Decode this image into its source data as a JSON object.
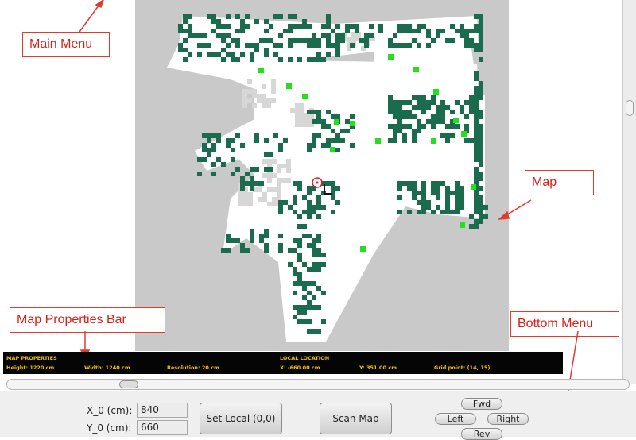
{
  "annotations": {
    "main_menu": "Main Menu",
    "map": "Map",
    "map_properties_bar": "Map Properties Bar",
    "bottom_menu": "Bottom Menu"
  },
  "map_properties": {
    "heading": "MAP PROPERTIES",
    "height": "Height: 1220 cm",
    "width": "Width: 1240 cm",
    "resolution": "Resolution: 20 cm"
  },
  "local_location": {
    "heading": "LOCAL LOCATION",
    "x": "X: -660.00 cm",
    "y": "Y: 351.00 cm",
    "grid_point": "Grid point: (14, 15)"
  },
  "bottom_menu": {
    "x0_label": "X_0 (cm):",
    "x0_value": "840",
    "y0_label": "Y_0 (cm):",
    "y0_value": "660",
    "set_local_button": "Set Local (0,0)",
    "scan_map_button": "Scan Map",
    "fwd_button": "Fwd",
    "left_button": "Left",
    "right_button": "Right",
    "rev_button": "Rev"
  },
  "colors": {
    "map_background": "#c9c9c9",
    "free_space": "#ffffff",
    "obstacle": "#1b6b4e",
    "highlight": "#22e01c",
    "annotation_red": "#d91f16",
    "bar_background": "#050505",
    "bar_text": "#f0c000"
  }
}
